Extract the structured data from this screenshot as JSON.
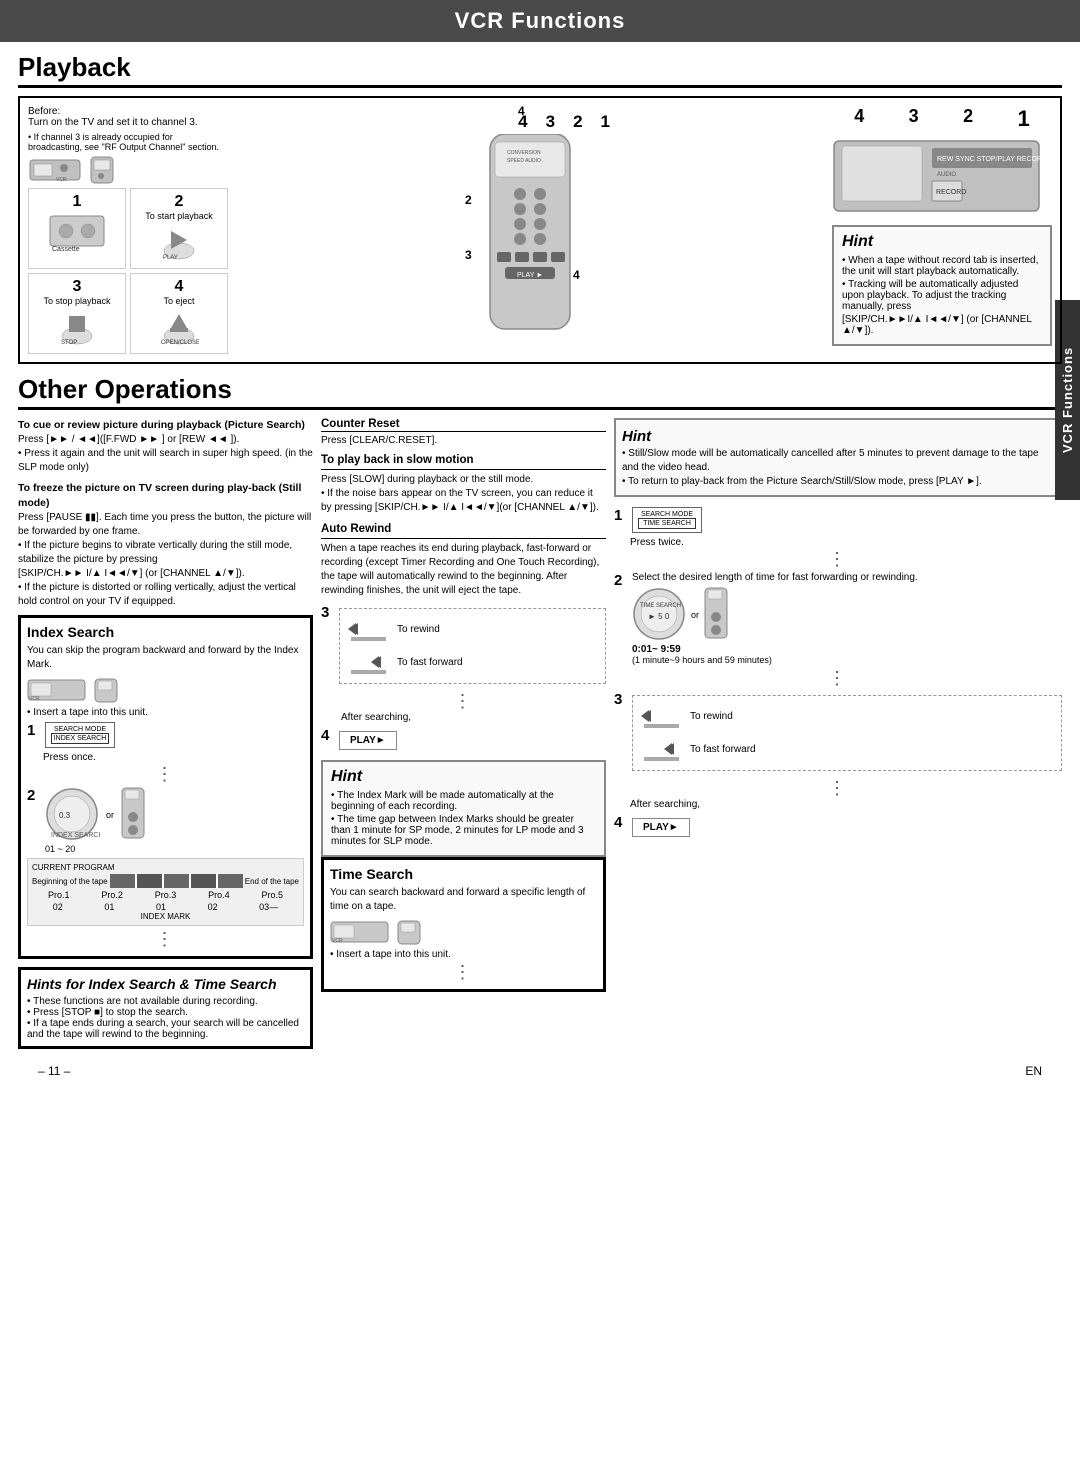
{
  "header": {
    "title": "VCR Functions"
  },
  "playback": {
    "title": "Playback",
    "before_label": "Before:",
    "before_text": "Turn on the TV and set it to channel 3.",
    "before_note": "• If channel 3 is already occupied for broadcasting, see \"RF Output Channel\" section.",
    "steps": [
      {
        "num": "1",
        "label": ""
      },
      {
        "num": "2",
        "label": "To start playback"
      },
      {
        "num": "3",
        "label": "To stop playback"
      },
      {
        "num": "4",
        "label": "To eject"
      }
    ],
    "num_labels": [
      "4",
      "3",
      "2",
      "1"
    ],
    "hint": {
      "title": "Hint",
      "lines": [
        "• When a tape without record tab is inserted, the unit will start playback automatically.",
        "• Tracking will be automatically adjusted upon playback. To adjust the tracking manually, press",
        "[SKIP/CH.►►I/▲ I◄◄/▼] (or [CHANNEL ▲/▼])."
      ]
    }
  },
  "other_operations": {
    "title": "Other Operations",
    "picture_search": {
      "heading": "To cue or review picture during playback (Picture Search)",
      "body": "Press [►► / ◄◄]([F.FWD ►► ] or [REW ◄◄ ]).\n• Press it again and the unit will search in super high speed. (in the SLP mode only)"
    },
    "still_mode": {
      "heading": "To freeze the picture on TV screen during play-back (Still mode)",
      "body": "Press [PAUSE ▮▮]. Each time you press the button, the picture will be forwarded by one frame.\n• If the picture begins to vibrate vertically during the still mode, stabilize the picture by pressing [SKIP/CH.►► I/▲ I◄◄/▼] (or [CHANNEL ▲/▼]).\n• If the picture is distorted or rolling vertically, adjust the vertical hold control on your TV if equipped."
    },
    "index_search": {
      "title": "Index Search",
      "body": "You can skip the program backward and forward by the Index Mark.",
      "insert_label": "• Insert a tape into this unit.",
      "step1_label": "Press once.",
      "step1_search_mode": "SEARCH MODE",
      "step1_index_label": "INDEX SEARCH",
      "step2_range": "01 ~ 20",
      "step2_index_label": "INDEX SEARCH",
      "step2_range_val": "0.3",
      "or_label": "or",
      "tape_diagram": {
        "label_beginning": "Beginning of the tape",
        "label_end": "End of the tape",
        "label_current": "CURRENT PROGRAM",
        "programs": [
          "Pro.1",
          "Pro.2",
          "Pro.3",
          "Pro.4",
          "Pro.5"
        ],
        "program_nums": [
          "02",
          "01",
          "01",
          "02",
          "03—"
        ],
        "index_mark": "INDEX MARK"
      }
    },
    "counter_reset": {
      "title": "Counter Reset",
      "body": "Press [CLEAR/C.RESET]."
    },
    "slow_motion": {
      "title": "To play back in slow motion",
      "body": "Press [SLOW] during playback or the still mode.\n• If the noise bars appear on the TV screen, you can reduce it by pressing [SKIP/CH.►► I/▲ I◄◄/▼](or [CHANNEL ▲/▼])."
    },
    "auto_rewind": {
      "title": "Auto Rewind",
      "body": "When a tape reaches its end during playback, fast-forward or recording (except Timer Recording and One Touch Recording), the tape will automatically rewind to the beginning. After rewinding finishes, the unit will eject the tape."
    },
    "index_rewind_steps": {
      "step3": {
        "num": "3",
        "to_rewind": "To rewind",
        "to_fast_forward": "To fast forward"
      },
      "step4": {
        "num": "4",
        "label": "PLAY►"
      },
      "hint": {
        "title": "Hint",
        "lines": [
          "• The Index Mark will be made automatically at the beginning of each recording.",
          "• The time gap between Index Marks should be greater than 1 minute for SP mode, 2 minutes for LP mode and 3 minutes for SLP mode."
        ]
      },
      "after_searching": "After searching,"
    },
    "time_search": {
      "title": "Time Search",
      "body": "You can search backward and forward a specific length of time on a tape.",
      "insert_label": "• Insert a tape into this unit.",
      "step1": {
        "num": "1",
        "label": "Press twice.",
        "search_mode": "SEARCH MODE",
        "time_search_label": "TIME SEARCH"
      },
      "step2": {
        "num": "2",
        "label": "Select the desired length of time for fast forwarding or rewinding.",
        "time_range": "0:01~ 9:59",
        "time_note": "(1 minute~9 hours and 59 minutes)",
        "time_search_label": "TIME SEARCH",
        "or_label": "or"
      },
      "step3": {
        "num": "3",
        "to_rewind": "To rewind",
        "to_fast_forward": "To fast forward",
        "after_searching": "After searching,"
      },
      "step4": {
        "num": "4",
        "label": "PLAY►"
      }
    },
    "hint_right": {
      "title": "Hint",
      "lines": [
        "• Still/Slow mode will be automatically cancelled after 5 minutes to prevent damage to the tape and the video head.",
        "• To return to play-back from the Picture Search/Still/Slow mode, press [PLAY ►]."
      ]
    },
    "hints_footer": {
      "title": "Hints for Index Search & Time Search",
      "lines": [
        "• These functions are not available during recording.",
        "• Press [STOP ■] to stop the search.",
        "• If a tape ends during a search, your search will be cancelled and the tape will rewind to the beginning."
      ]
    }
  },
  "sidebar": {
    "label": "VCR Functions"
  },
  "footer": {
    "page_num": "– 11 –",
    "lang": "EN"
  }
}
